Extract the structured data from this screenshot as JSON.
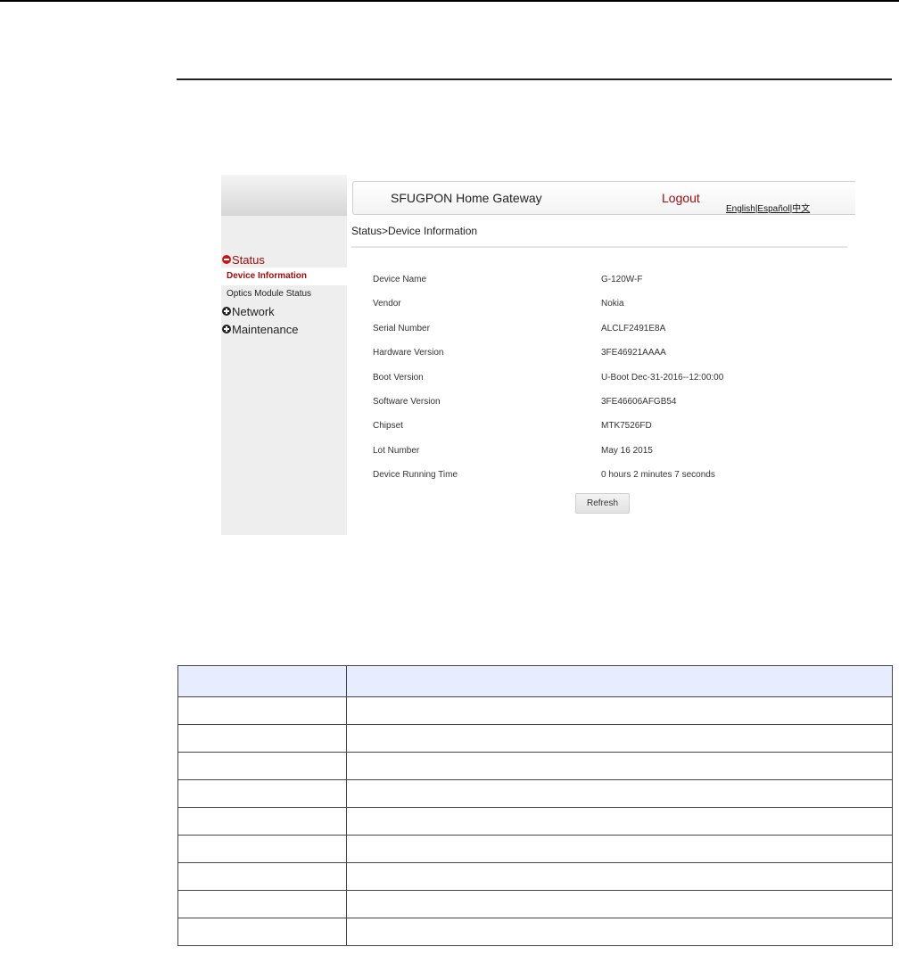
{
  "app": {
    "title": "SFUGPON Home Gateway",
    "logout_label": "Logout",
    "languages": [
      "English",
      "Español",
      "中文"
    ]
  },
  "sidebar": {
    "groups": [
      {
        "label": "Status",
        "expanded": true,
        "items": [
          {
            "label": "Device Information",
            "selected": true
          },
          {
            "label": "Optics Module Status",
            "selected": false
          }
        ]
      },
      {
        "label": "Network",
        "expanded": false
      },
      {
        "label": "Maintenance",
        "expanded": false
      }
    ]
  },
  "breadcrumb": "Status>Device Information",
  "device_info": [
    {
      "label": "Device Name",
      "value": "G-120W-F"
    },
    {
      "label": "Vendor",
      "value": "Nokia"
    },
    {
      "label": "Serial Number",
      "value": "ALCLF2491E8A"
    },
    {
      "label": "Hardware Version",
      "value": "3FE46921AAAA"
    },
    {
      "label": "Boot Version",
      "value": "U-Boot Dec-31-2016--12:00:00"
    },
    {
      "label": "Software Version",
      "value": "3FE46606AFGB54"
    },
    {
      "label": "Chipset",
      "value": "MTK7526FD"
    },
    {
      "label": "Lot Number",
      "value": "May 16 2015"
    },
    {
      "label": "Device Running Time",
      "value": "0 hours 2 minutes 7 seconds"
    }
  ],
  "refresh_label": "Refresh",
  "colors": {
    "accent_red": "#a10d0d",
    "table_header_bg": "#e8ecff"
  }
}
